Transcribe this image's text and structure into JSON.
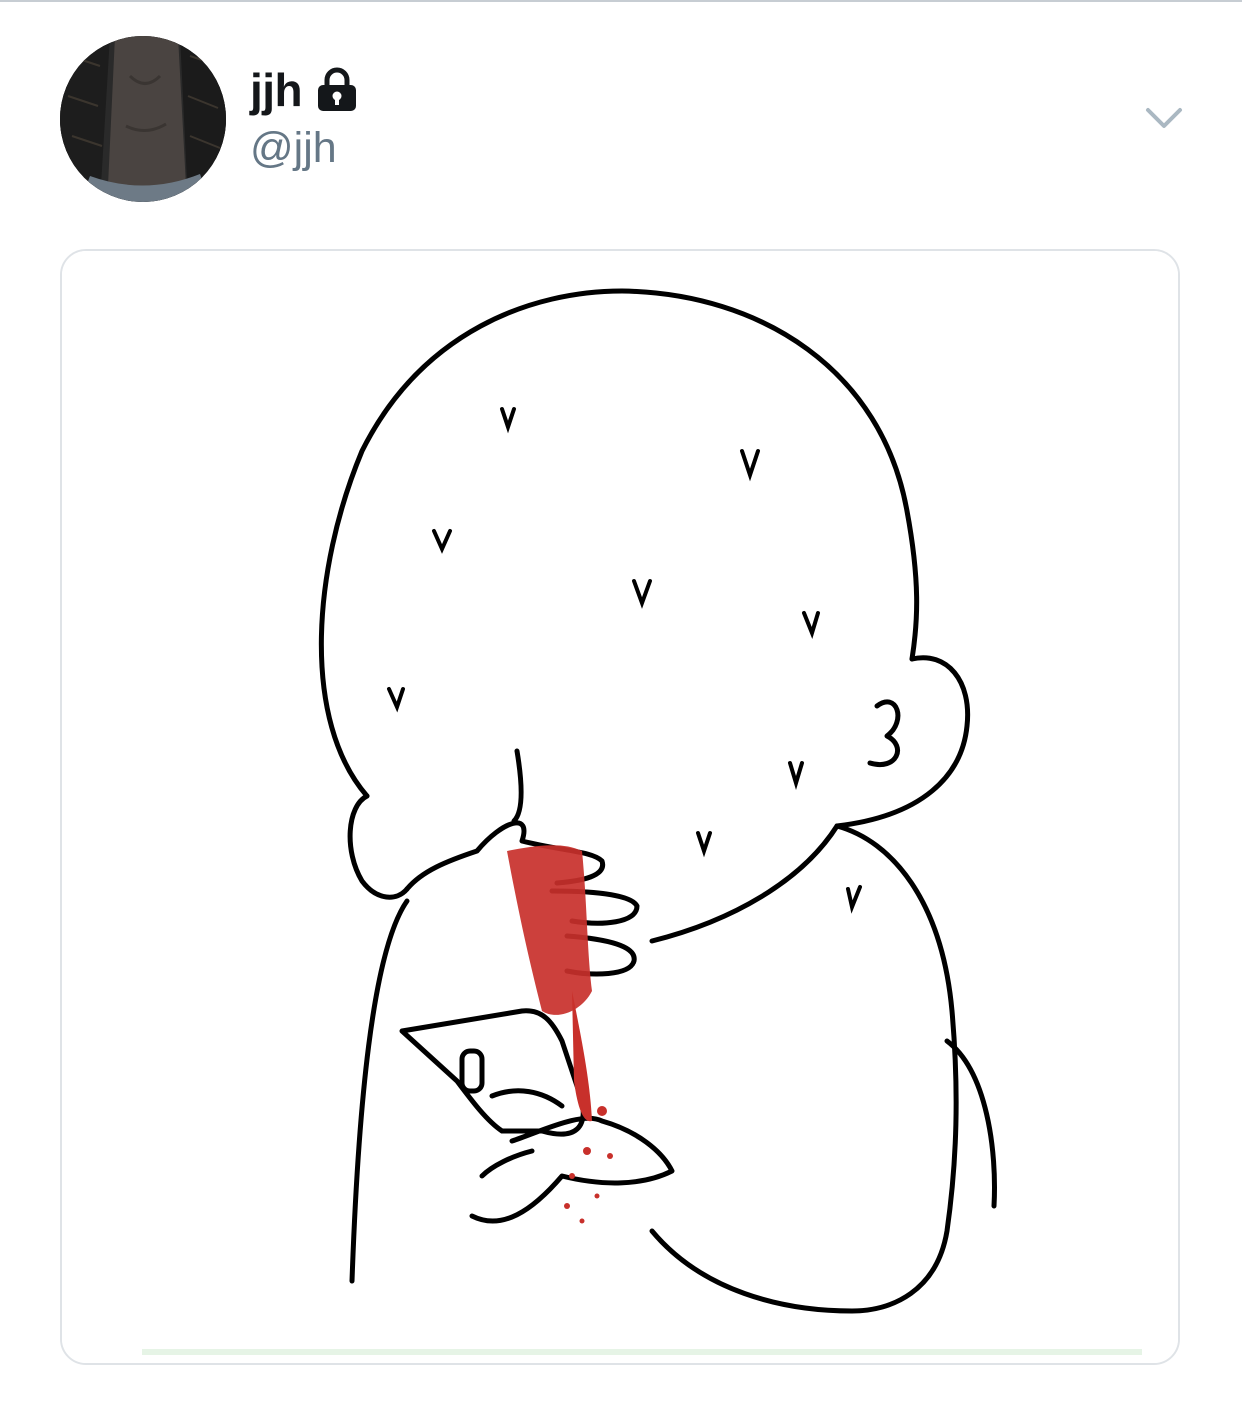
{
  "tweet": {
    "display_name": "jjh",
    "handle": "@jjh",
    "protected_icon": "lock-icon",
    "menu_icon": "chevron-down-icon"
  },
  "media": {
    "kind": "cartoon illustration",
    "accent_color": "#c8302b"
  },
  "colors": {
    "name": "#14171a",
    "handle": "#657786",
    "divider": "#c7cdd3",
    "card_border": "#dfe3e7"
  }
}
